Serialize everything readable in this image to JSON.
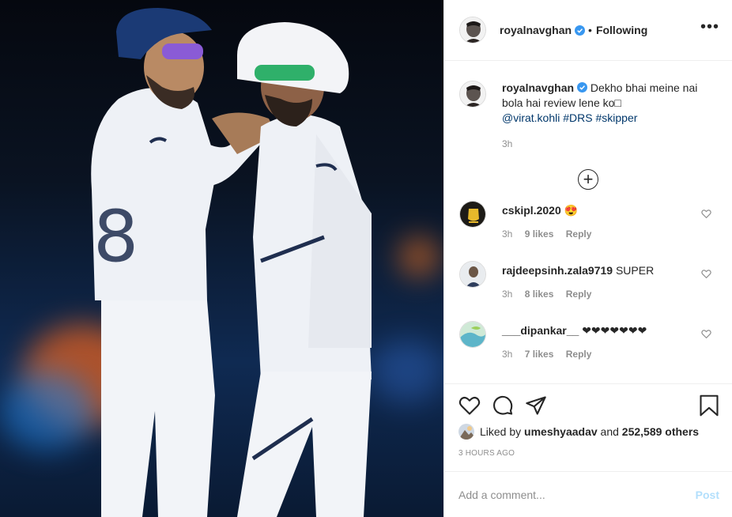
{
  "post": {
    "author": "royalnavghan",
    "separator": "•",
    "follow_status": "Following",
    "more_glyph": "•••"
  },
  "caption": {
    "username": "royalnavghan",
    "text": "Dekho bhai meine nai bola hai review lene ko",
    "mention": "@virat.kohli",
    "hashtags": [
      "#DRS",
      "#skipper"
    ],
    "time": "3h"
  },
  "load_more_glyph": "+",
  "comments": [
    {
      "username": "cskipl.2020",
      "text": "😍",
      "time": "3h",
      "likes": "9 likes",
      "reply": "Reply"
    },
    {
      "username": "rajdeepsinh.zala9719",
      "text": "SUPER",
      "time": "3h",
      "likes": "8 likes",
      "reply": "Reply"
    },
    {
      "username": "___dipankar__",
      "text": "❤❤❤❤❤❤❤",
      "time": "3h",
      "likes": "7 likes",
      "reply": "Reply"
    }
  ],
  "likes": {
    "prefix": "Liked by",
    "user": "umeshyaadav",
    "middle": "and",
    "others": "252,589 others"
  },
  "posted_ago": "3 HOURS AGO",
  "comment_box": {
    "placeholder": "Add a comment...",
    "post_label": "Post"
  },
  "colors": {
    "link": "#00376b",
    "muted": "#8e8e8e",
    "post_disabled": "#b2dffc",
    "verified": "#3897f0"
  },
  "icons": [
    "verified-badge-icon",
    "more-options-icon",
    "add-circle-icon",
    "heart-icon",
    "comment-icon",
    "share-icon",
    "bookmark-icon"
  ]
}
